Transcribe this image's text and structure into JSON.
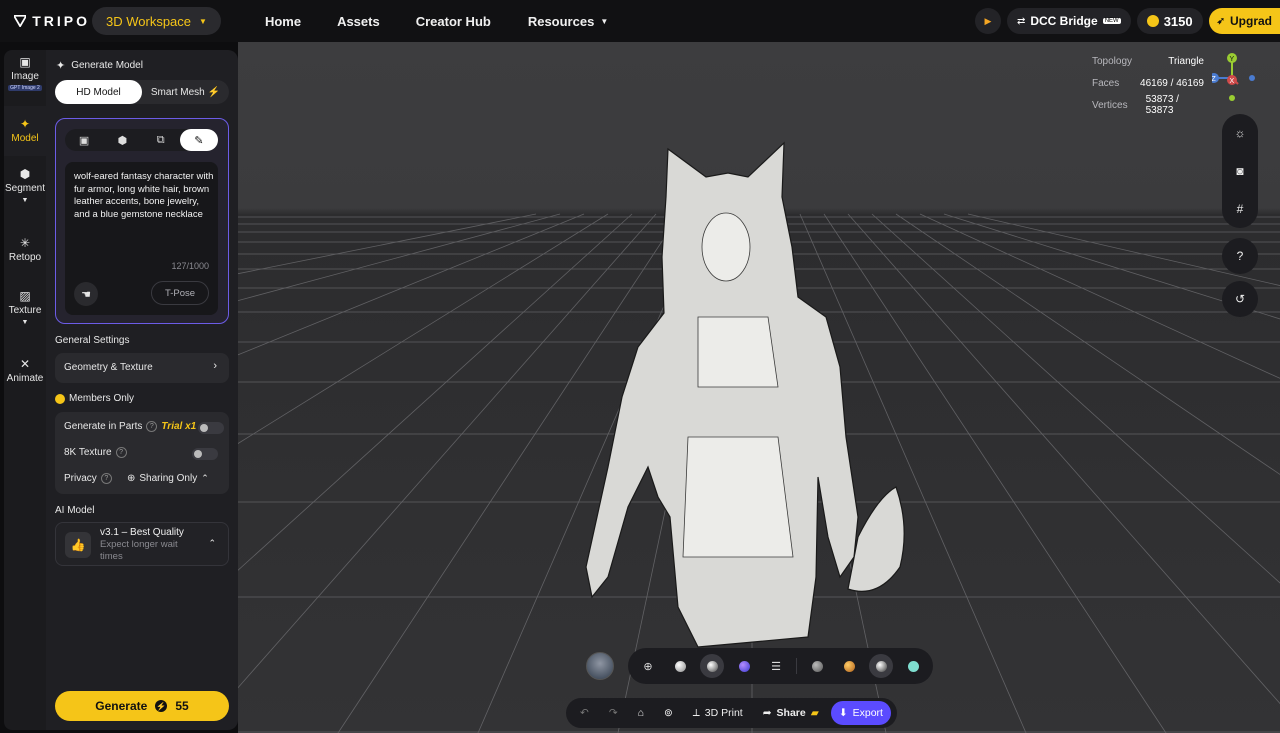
{
  "topbar": {
    "logo": "TRIPO",
    "workspace": "3D Workspace",
    "nav": [
      "Home",
      "Assets",
      "Creator Hub",
      "Resources"
    ],
    "dcc_bridge": "DCC Bridge",
    "dcc_badge": "NEW",
    "credits": "3150",
    "upgrade": "Upgrad"
  },
  "rail": {
    "items": [
      {
        "label": "Image",
        "badge": "GPT Image 2",
        "icon": "image-icon"
      },
      {
        "label": "Model",
        "icon": "sparkle-icon"
      },
      {
        "label": "Segment",
        "icon": "cube-icon"
      },
      {
        "label": "Retopo",
        "icon": "mesh-icon"
      },
      {
        "label": "Texture",
        "icon": "hatch-icon"
      },
      {
        "label": "Animate",
        "icon": "figure-icon"
      }
    ]
  },
  "panel": {
    "title": "Generate Model",
    "tabs": [
      "HD Model",
      "Smart Mesh"
    ],
    "prompt": "wolf-eared fantasy character with fur armor, long white hair, brown leather accents, bone jewelry, and a blue gemstone necklace",
    "char_count": "127/1000",
    "tpose": "T-Pose",
    "general_settings": "General Settings",
    "geometry_texture": "Geometry & Texture",
    "members_only": "Members Only",
    "generate_in_parts": "Generate in Parts",
    "trial": "Trial x1",
    "texture_8k": "8K Texture",
    "privacy": "Privacy",
    "privacy_value": "Sharing Only",
    "ai_model_label": "AI Model",
    "ai_model_name": "v3.1 – Best Quality",
    "ai_model_sub": "Expect longer wait times",
    "generate": "Generate",
    "generate_cost": "55"
  },
  "viewport": {
    "topology_label": "Topology",
    "topology_value": "Triangle",
    "faces_label": "Faces",
    "faces_value": "46169 / 46169",
    "vertices_label": "Vertices",
    "vertices_value": "53873 / 53873",
    "gizmo": {
      "y": "Y",
      "x": "X",
      "z": "Z"
    }
  },
  "actions": {
    "print": "3D Print",
    "share": "Share",
    "export": "Export"
  },
  "colors": {
    "accent": "#f5c518",
    "export": "#5b4bff",
    "prompt_border": "#6c5ce7"
  }
}
